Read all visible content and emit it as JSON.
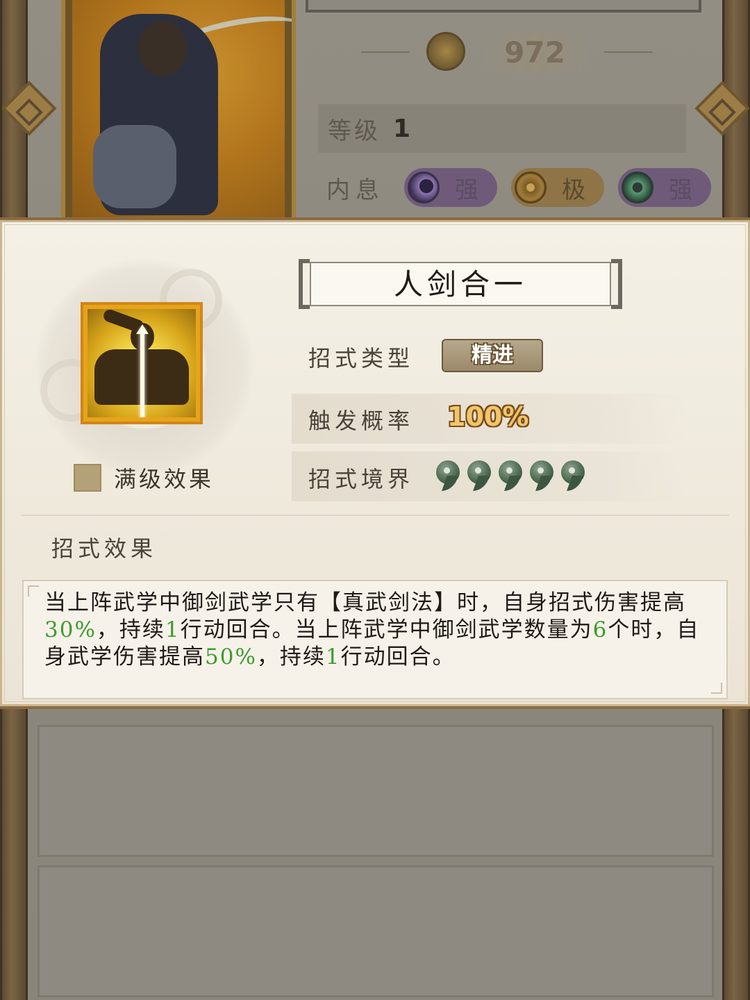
{
  "background": {
    "power_value": "972",
    "level_label": "等级",
    "level_value": "1",
    "neixi_label": "内息",
    "neixi": [
      {
        "icon": "moon-orb-icon",
        "label": "强",
        "color": "#6f5a7a"
      },
      {
        "icon": "sun-orb-icon",
        "label": "极",
        "color": "#8e7447"
      },
      {
        "icon": "jade-orb-icon",
        "label": "强",
        "color": "#6f5a7a"
      }
    ]
  },
  "dialog": {
    "skill_name": "人剑合一",
    "max_level_label": "满级效果",
    "attributes": {
      "type_label": "招式类型",
      "type_value": "精进",
      "rate_label": "触发概率",
      "rate_value": "100%",
      "realm_label": "招式境界",
      "realm_level": 5
    },
    "effect_heading": "招式效果",
    "effect_text": [
      {
        "t": "当上阵武学中御剑武学只有【真武剑法】时，自身招式伤害提高",
        "hl": false
      },
      {
        "t": "30%",
        "hl": true
      },
      {
        "t": "，持续",
        "hl": false
      },
      {
        "t": "1",
        "hl": true
      },
      {
        "t": "行动回合。当上阵武学中御剑武学数量为",
        "hl": false
      },
      {
        "t": "6",
        "hl": true
      },
      {
        "t": "个时，自身武学伤害提高",
        "hl": false
      },
      {
        "t": "50%",
        "hl": true
      },
      {
        "t": "，持续",
        "hl": false
      },
      {
        "t": "1",
        "hl": true
      },
      {
        "t": "行动回合。",
        "hl": false
      }
    ]
  },
  "colors": {
    "highlight": "#3e9a2c",
    "frame": "#8b6a3f",
    "icon_frame": "#e7a41a"
  }
}
